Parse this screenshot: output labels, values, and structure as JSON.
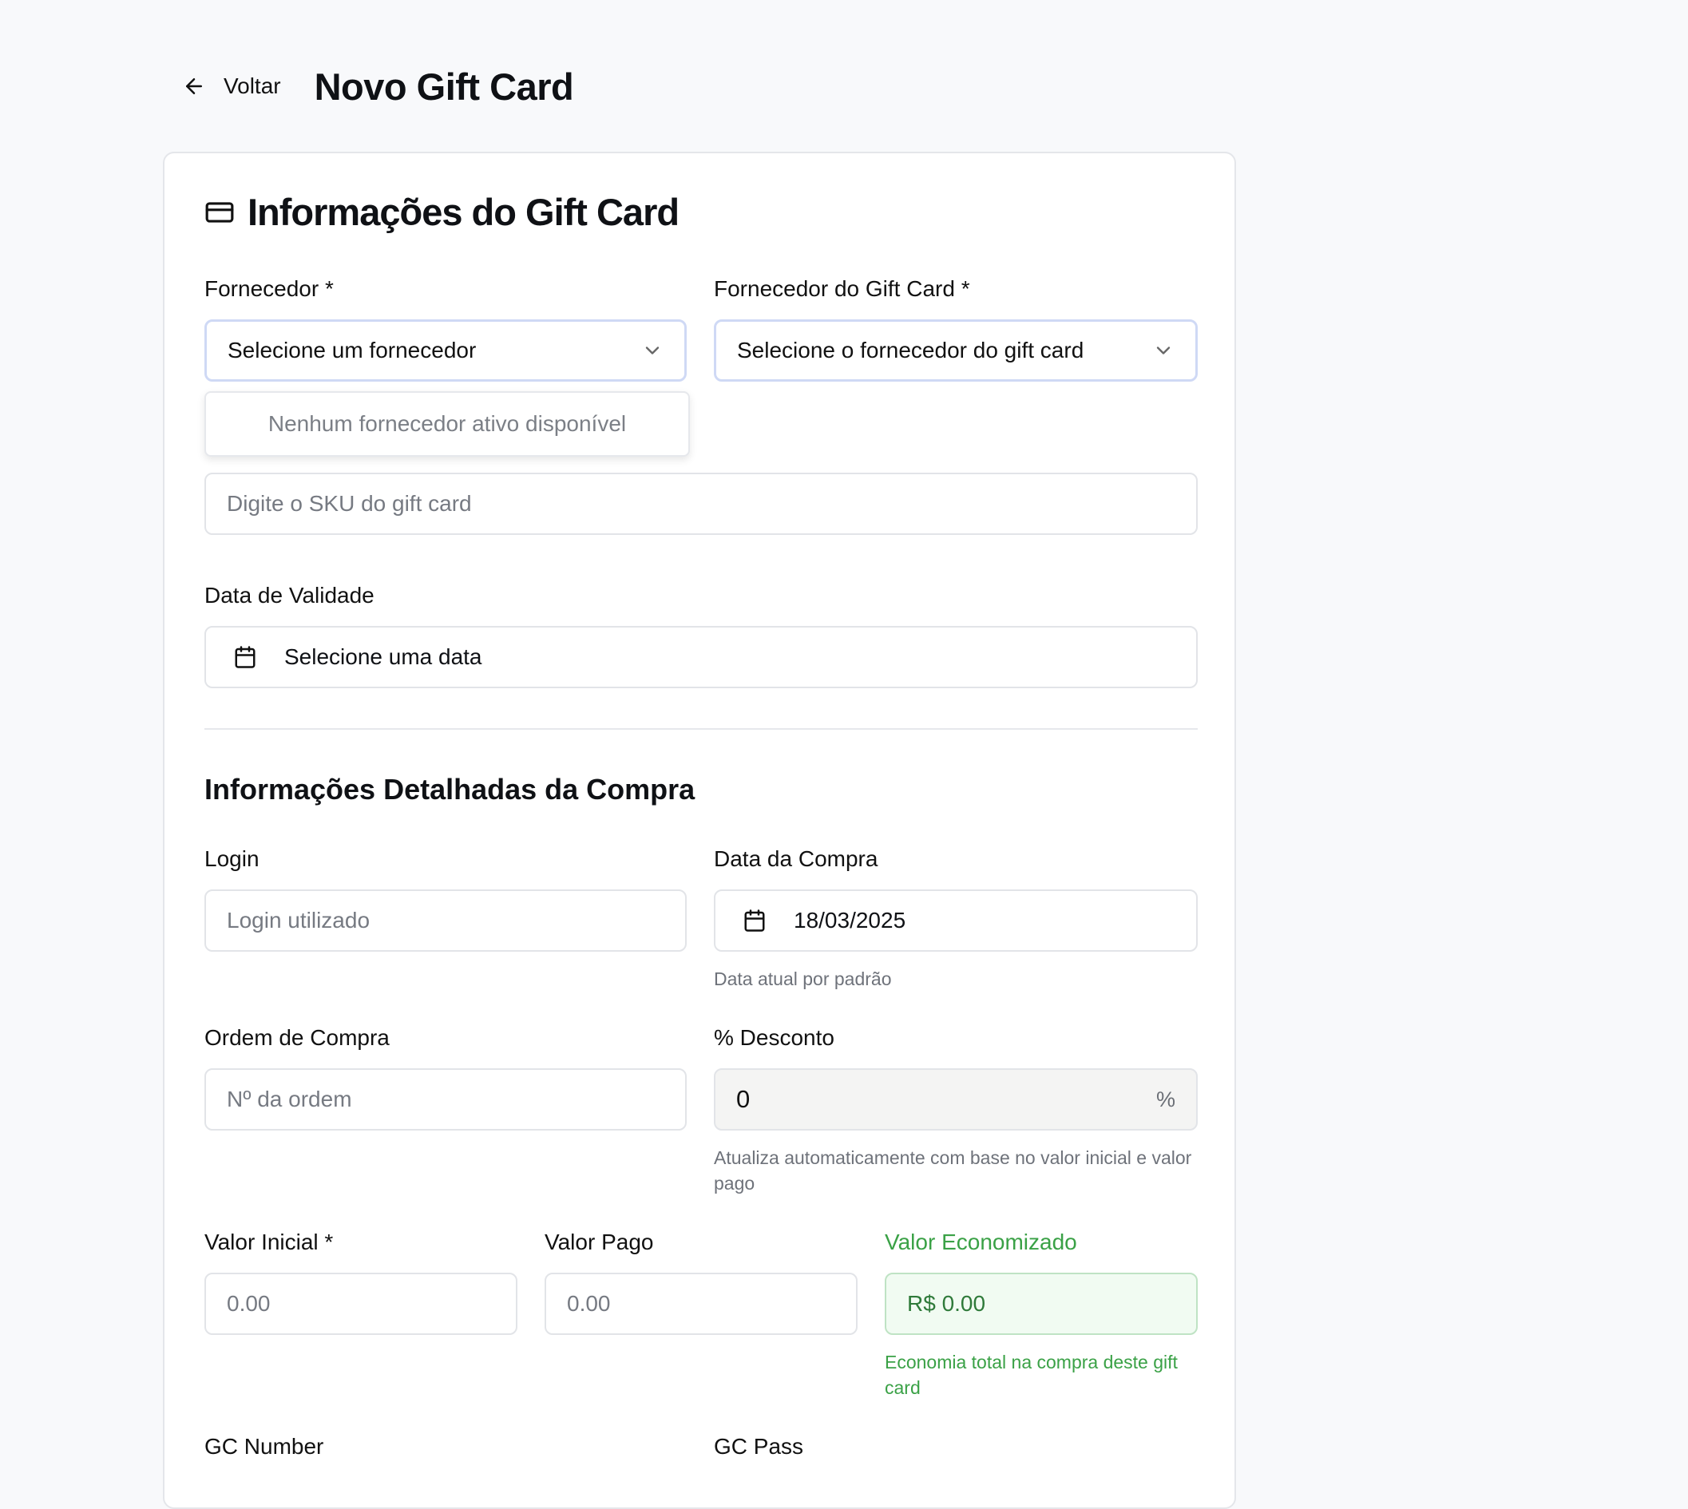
{
  "header": {
    "back_label": "Voltar",
    "page_title": "Novo Gift Card"
  },
  "card": {
    "title": "Informações do Gift Card",
    "fornecedor": {
      "label": "Fornecedor *",
      "value": "Selecione um fornecedor",
      "dropdown_empty": "Nenhum fornecedor ativo disponível"
    },
    "fornecedor_gc": {
      "label": "Fornecedor do Gift Card *",
      "value": "Selecione o fornecedor do gift card"
    },
    "sku": {
      "placeholder": "Digite o SKU do gift card"
    },
    "validade": {
      "label": "Data de Validade",
      "value": "Selecione uma data"
    }
  },
  "compra": {
    "title": "Informações Detalhadas da Compra",
    "login": {
      "label": "Login",
      "placeholder": "Login utilizado"
    },
    "data_compra": {
      "label": "Data da Compra",
      "value": "18/03/2025",
      "help": "Data atual por padrão"
    },
    "ordem": {
      "label": "Ordem de Compra",
      "placeholder": "Nº da ordem"
    },
    "desconto": {
      "label": "% Desconto",
      "value": "0",
      "suffix": "%",
      "help": "Atualiza automaticamente com base no valor inicial e valor pago"
    },
    "valor_inicial": {
      "label": "Valor Inicial *",
      "placeholder": "0.00"
    },
    "valor_pago": {
      "label": "Valor Pago",
      "placeholder": "0.00"
    },
    "valor_economizado": {
      "label": "Valor Economizado",
      "value": "R$ 0.00",
      "help": "Economia total na compra deste gift card"
    },
    "gc_number": {
      "label": "GC Number"
    },
    "gc_pass": {
      "label": "GC Pass"
    }
  }
}
